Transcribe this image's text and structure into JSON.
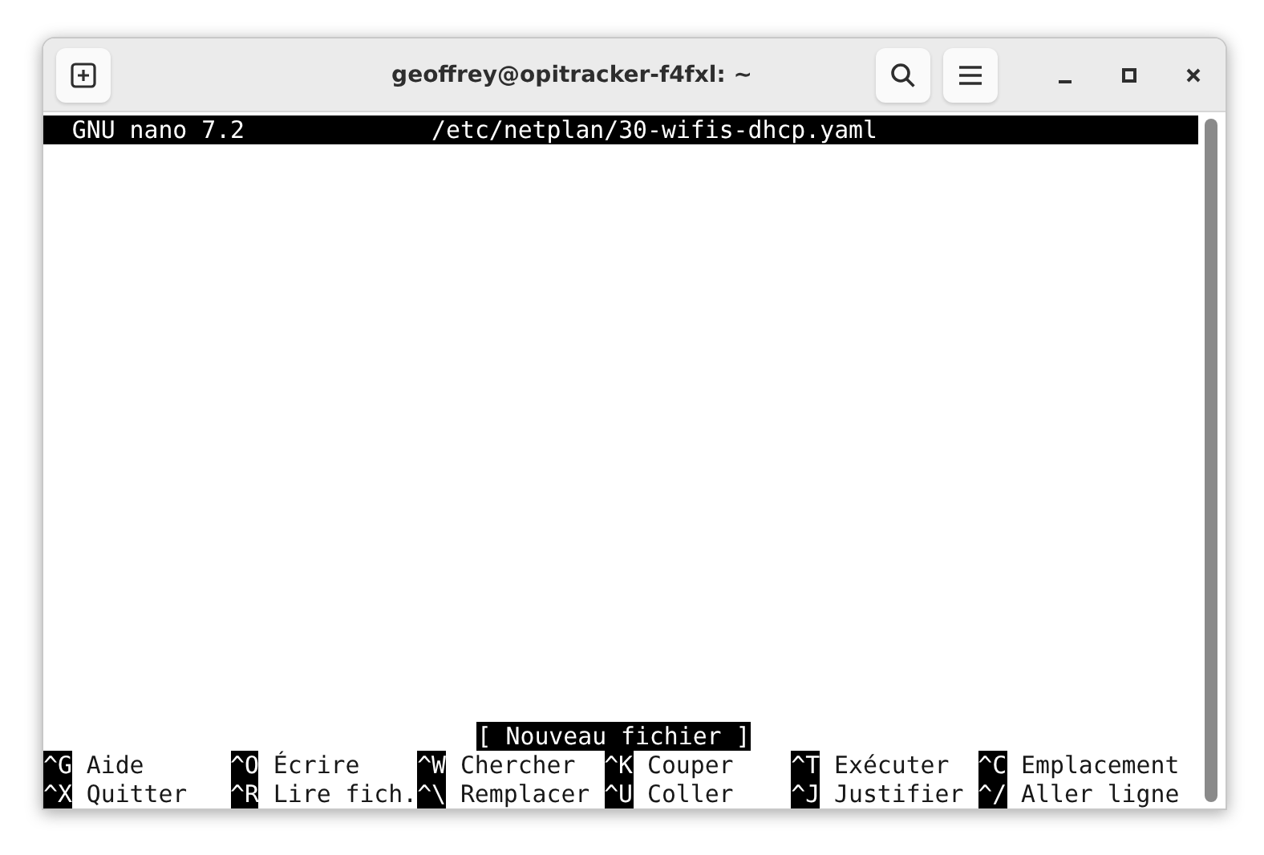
{
  "window": {
    "title": "geoffrey@opitracker-f4fxl: ~"
  },
  "nano": {
    "program": "GNU nano 7.2",
    "filename": "/etc/netplan/30-wifis-dhcp.yaml",
    "status_message": "[ Nouveau fichier ]",
    "shortcuts": [
      [
        {
          "key": "^G",
          "label": "Aide"
        },
        {
          "key": "^O",
          "label": "Écrire"
        },
        {
          "key": "^W",
          "label": "Chercher"
        },
        {
          "key": "^K",
          "label": "Couper"
        },
        {
          "key": "^T",
          "label": "Exécuter"
        },
        {
          "key": "^C",
          "label": "Emplacement"
        }
      ],
      [
        {
          "key": "^X",
          "label": "Quitter"
        },
        {
          "key": "^R",
          "label": "Lire fich."
        },
        {
          "key": "^\\",
          "label": "Remplacer"
        },
        {
          "key": "^U",
          "label": "Coller"
        },
        {
          "key": "^J",
          "label": "Justifier"
        },
        {
          "key": "^/",
          "label": "Aller ligne"
        }
      ]
    ]
  }
}
